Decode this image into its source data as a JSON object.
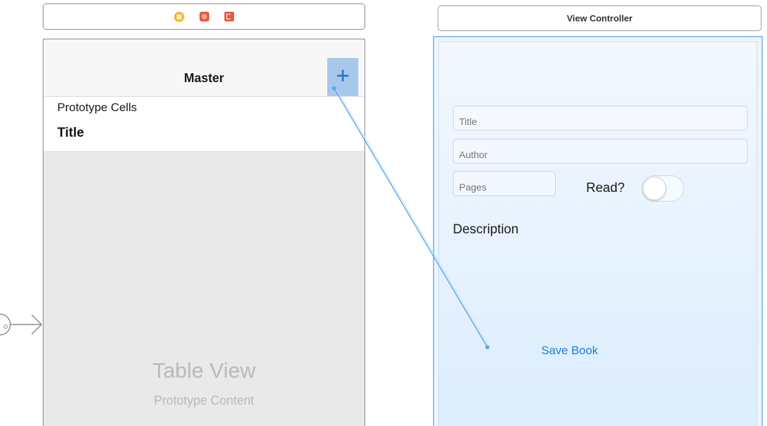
{
  "master_scene": {
    "dock_icons": [
      "view-controller-icon",
      "first-responder-icon",
      "exit-icon"
    ],
    "nav_title": "Master",
    "add_button_glyph": "+",
    "prototype_header": "Prototype Cells",
    "cell_title": "Title",
    "table_view_title": "Table View",
    "table_view_subtitle": "Prototype Content"
  },
  "detail_scene": {
    "dock_title": "View Controller",
    "title_placeholder": "Title",
    "author_placeholder": "Author",
    "pages_placeholder": "Pages",
    "read_label": "Read?",
    "read_toggle_on": false,
    "description_label": "Description",
    "save_button": "Save Book"
  },
  "colors": {
    "accent": "#1f7ae0",
    "segue_line": "#5aaaf0",
    "selection": "#a8c8ea"
  }
}
